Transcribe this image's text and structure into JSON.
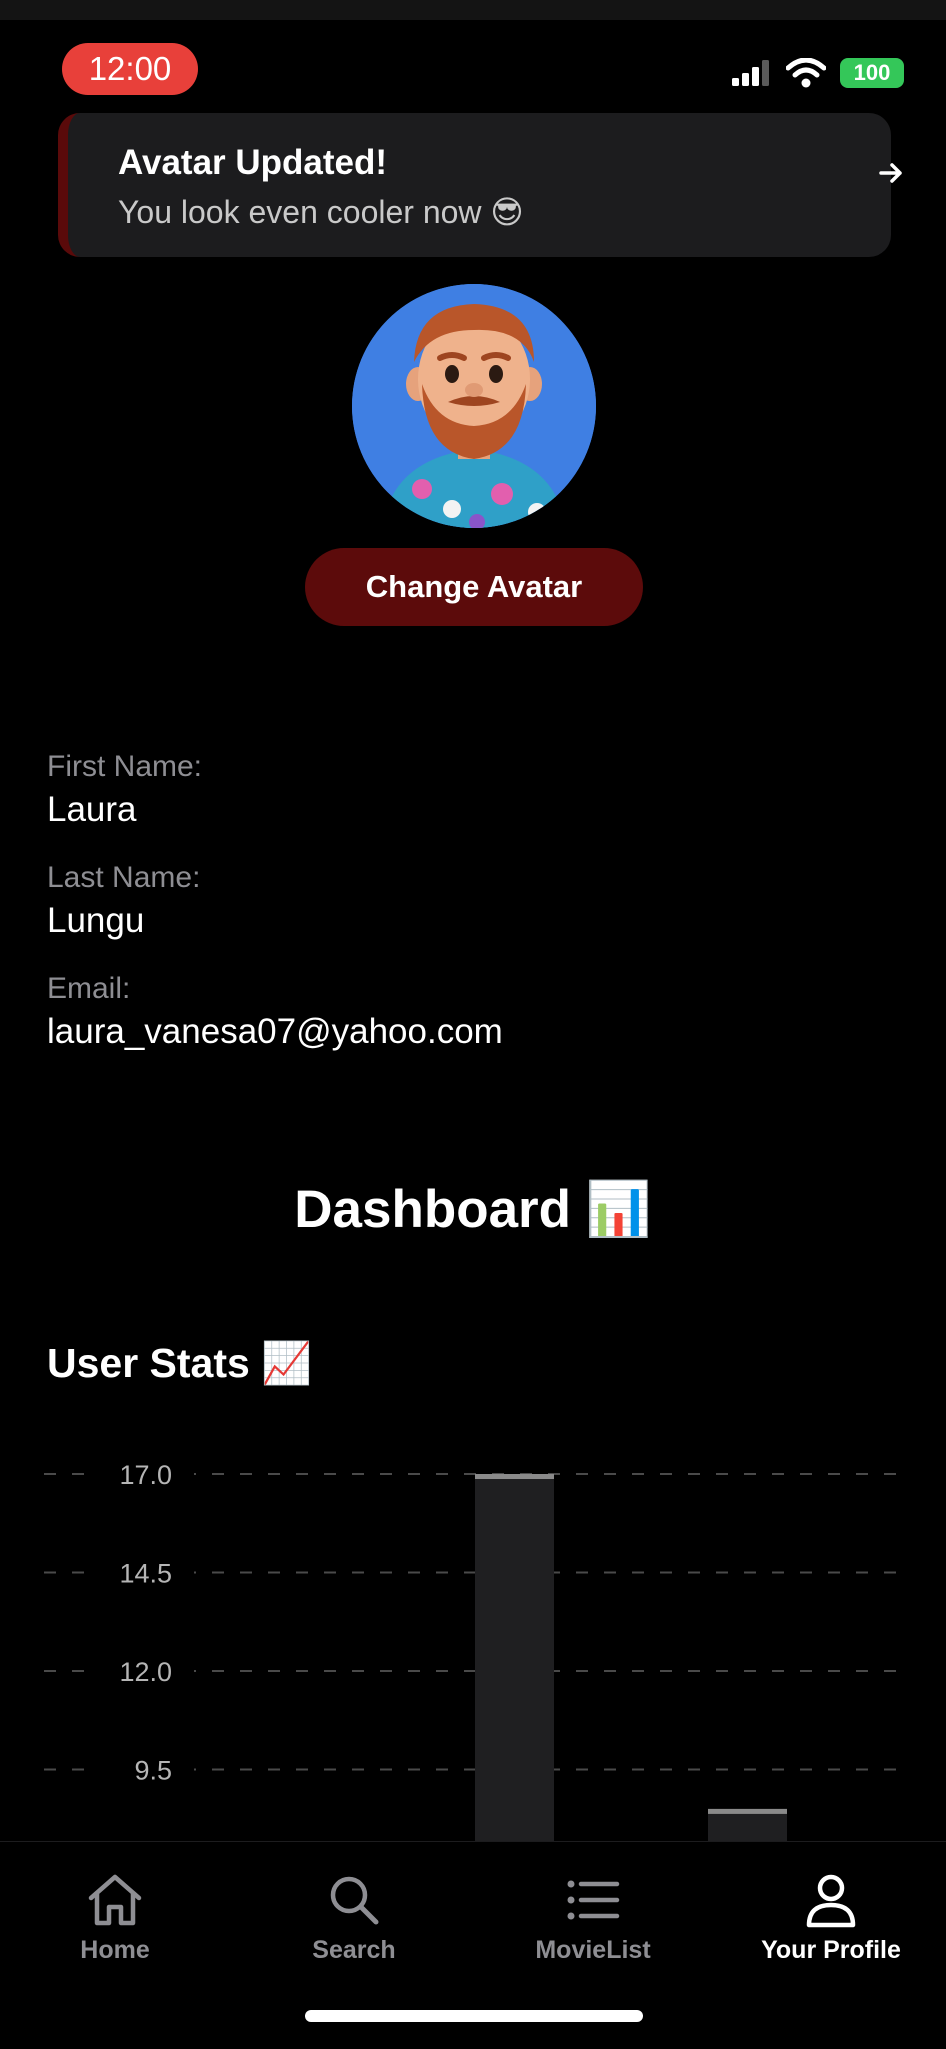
{
  "status": {
    "time": "12:00",
    "battery": "100"
  },
  "toast": {
    "title": "Avatar Updated!",
    "message": "You look even cooler now 😎"
  },
  "profile": {
    "change_avatar_label": "Change Avatar",
    "first_name_label": "First Name:",
    "first_name": "Laura",
    "last_name_label": "Last Name:",
    "last_name": "Lungu",
    "email_label": "Email:",
    "email": "laura_vanesa07@yahoo.com"
  },
  "dashboard": {
    "title": "Dashboard 📊",
    "stats_title": "User Stats 📈"
  },
  "chart_data": {
    "type": "bar",
    "y_ticks": [
      "17.0",
      "14.5",
      "12.0",
      "9.5"
    ],
    "ylim": [
      9.5,
      17.0
    ],
    "grid": true,
    "values": [
      17,
      8.5
    ],
    "bar_color": "#1f1f21",
    "bar_top_color": "#8a8a8a"
  },
  "tabbar": {
    "items": [
      {
        "label": "Home",
        "icon": "home-icon"
      },
      {
        "label": "Search",
        "icon": "search-icon"
      },
      {
        "label": "MovieList",
        "icon": "list-icon"
      },
      {
        "label": "Your Profile",
        "icon": "person-icon",
        "active": true
      }
    ]
  },
  "colors": {
    "accent": "#5c0b0b",
    "time_pill": "#e8403a",
    "battery": "#34c759"
  }
}
